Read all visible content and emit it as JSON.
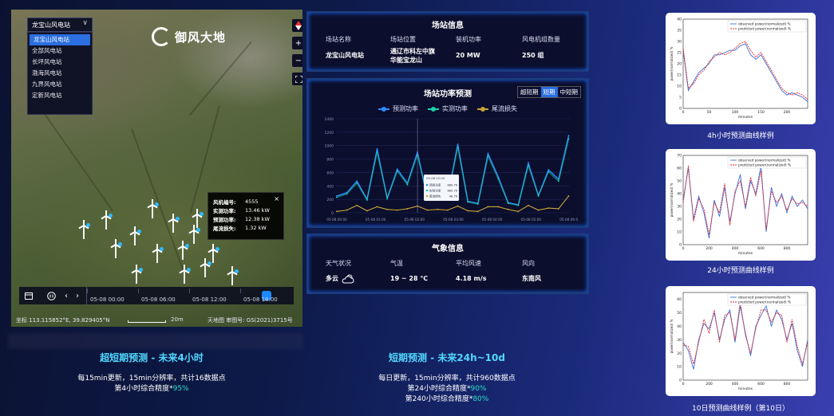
{
  "colors": {
    "accent_blue": "#2b6fe0",
    "pred_line": "#2e8bff",
    "actual_line": "#19d3a6",
    "wake_loss": "#c9a437",
    "observed_curve": "#3a6fd8",
    "predicted_curve": "#e0292e",
    "highlight_text": "#27e0c8"
  },
  "map": {
    "dropdown_value": "龙宝山风电站",
    "dropdown_icon": "chevron-down-icon",
    "menu_items": [
      "龙宝山风电站",
      "全部风电站",
      "长坪风电站",
      "渤海风电站",
      "九界风电站",
      "定新风电站"
    ],
    "logo_text": "御风大地",
    "controls": [
      "compass-icon",
      "zoom-in-icon",
      "zoom-out-icon",
      "fullscreen-icon"
    ],
    "tooltip": {
      "rows": [
        {
          "label": "风机编号:",
          "value": "4555"
        },
        {
          "label": "实测功率:",
          "value": "13.46 kW"
        },
        {
          "label": "预测功率:",
          "value": "12.38 kW"
        },
        {
          "label": "尾流损失:",
          "value": "1.32 kW"
        }
      ],
      "close": "×"
    },
    "timeline": {
      "ticks": [
        "05-08 00:00",
        "05-08 06:00",
        "05-08 12:00",
        "05-08 18:00"
      ],
      "icons": [
        "calendar-icon",
        "pause-icon",
        "prev-icon",
        "next-icon"
      ]
    },
    "status": {
      "coords": "坐标 113.115852°E, 39.829405°N",
      "scale": "20m",
      "credit": "天地图 审图号: GS(2021)3715号"
    }
  },
  "station": {
    "title": "场站信息",
    "labels": [
      "场站名称",
      "场站位置",
      "装机功率",
      "风电机组数量"
    ],
    "values": [
      "龙宝山风电站",
      "通辽市科左中旗\n华能宝龙山",
      "20 MW",
      "250 组"
    ]
  },
  "forecast": {
    "title": "场站功率预测",
    "tabs": [
      "超短期",
      "短期",
      "中短期"
    ],
    "active_tab": "短期",
    "legend": [
      "预测功率",
      "实测功率",
      "尾流损失"
    ]
  },
  "chart_data": {
    "type": "line",
    "title": "场站功率预测",
    "x": [
      "05-08 00:00",
      "05-08 00:15",
      "05-08 00:30",
      "05-08 00:45",
      "05-08 01:00",
      "05-08 01:15",
      "05-08 01:30",
      "05-08 01:45",
      "05-08 02:00",
      "05-08 02:15",
      "05-08 02:30",
      "05-08 02:45",
      "05-08 03:00",
      "05-08 03:15",
      "05-08 03:30",
      "05-08 03:45",
      "05-08 04:00",
      "05-08 04:15",
      "05-08 04:30",
      "05-08 04:45",
      "05-08 05:00",
      "05-08 05:15",
      "05-08 05:30",
      "05-08 05:45"
    ],
    "xticks": [
      "05-08 00:00",
      "05-08 01:00",
      "05-08 02:00",
      "05-08 03:00",
      "05-08 04:00",
      "05-08 05:00",
      "05-08 06:00"
    ],
    "yticks": [
      0,
      200,
      400,
      600,
      800,
      1000,
      1200,
      1400
    ],
    "ylim": [
      0,
      1400
    ],
    "series": [
      {
        "name": "预测功率",
        "values": [
          250,
          300,
          470,
          200,
          950,
          220,
          650,
          440,
          900,
          220,
          380,
          240,
          1020,
          170,
          140,
          880,
          540,
          150,
          120,
          740,
          260,
          640,
          500,
          1150
        ]
      },
      {
        "name": "实测功率",
        "values": [
          230,
          280,
          440,
          190,
          900,
          210,
          620,
          420,
          860,
          210,
          360,
          230,
          980,
          160,
          130,
          840,
          510,
          140,
          110,
          700,
          250,
          610,
          470,
          1100
        ]
      },
      {
        "name": "尾流损失",
        "values": [
          20,
          40,
          110,
          30,
          90,
          50,
          40,
          60,
          100,
          40,
          50,
          40,
          100,
          30,
          20,
          90,
          90,
          50,
          20,
          110,
          40,
          70,
          60,
          250
        ]
      }
    ],
    "tooltip": {
      "title": "05-08 02:00",
      "items": [
        {
          "name": "预测功率",
          "value": "880.76"
        },
        {
          "name": "实测功率",
          "value": "880.76"
        },
        {
          "name": "尾流损失",
          "value": "48.76"
        }
      ]
    }
  },
  "weather": {
    "title": "气象信息",
    "labels": [
      "天气状况",
      "气温",
      "平均风速",
      "风向"
    ],
    "values": [
      "多云",
      "19 ~ 28 ℃",
      "4.18 m/s",
      "东南风"
    ],
    "icon": "cloudy-icon"
  },
  "bottom": {
    "left_title": "超短期预测 - 未来4小时",
    "left_line1": "每15min更新，15min分辨率，共计16数据点",
    "left_line2_prefix": "第4小时综合精度*",
    "left_line2_value": "95%",
    "right_title": "短期预测 - 未来24h~10d",
    "right_line1": "每日更新，15min分辨率，共计960数据点",
    "right_line2_prefix": "第24小时综合精度*",
    "right_line2_value": "90%",
    "right_line3_prefix": "第240小时综合精度*",
    "right_line3_value": "80%"
  },
  "samples": [
    {
      "caption": "4h小时预测曲线样例",
      "legend": [
        "observed power(normalized) %",
        "predicted power(normalized) %"
      ],
      "xlabel": "minutes",
      "ylabel": "power(normalized) %",
      "xticks": [
        0,
        50,
        100,
        150,
        200
      ],
      "yticks": [
        0,
        5,
        10,
        15,
        20,
        25,
        30,
        35,
        40
      ],
      "xlim": [
        0,
        240
      ],
      "ylim": [
        0,
        40
      ],
      "x": [
        0,
        10,
        20,
        30,
        40,
        50,
        60,
        70,
        80,
        90,
        100,
        110,
        120,
        130,
        140,
        150,
        160,
        170,
        180,
        190,
        200,
        210,
        220,
        230,
        240
      ],
      "observed": [
        26,
        8,
        12,
        16,
        18,
        20,
        24,
        24,
        25,
        26,
        26,
        28,
        29,
        24,
        22,
        24,
        20,
        16,
        12,
        8,
        6,
        7,
        6,
        5,
        3
      ],
      "predicted": [
        27,
        9,
        11,
        15,
        17,
        21,
        23,
        25,
        24,
        25,
        27,
        29,
        30,
        26,
        23,
        25,
        21,
        17,
        13,
        9,
        7,
        6,
        7,
        6,
        4
      ]
    },
    {
      "caption": "24小时预测曲线样例",
      "legend": [
        "observed power(normalized) %",
        "predicted power(normalized) %"
      ],
      "xlabel": "minutes",
      "ylabel": "power(normalized) %",
      "xticks": [
        0,
        200,
        400,
        600,
        800
      ],
      "yticks": [
        0,
        10,
        20,
        30,
        40,
        50,
        60,
        70
      ],
      "xlim": [
        0,
        960
      ],
      "ylim": [
        0,
        70
      ],
      "x": [
        0,
        40,
        80,
        120,
        160,
        200,
        240,
        280,
        320,
        360,
        400,
        440,
        480,
        520,
        560,
        600,
        640,
        680,
        720,
        760,
        800,
        840,
        880,
        920,
        960
      ],
      "observed": [
        35,
        60,
        20,
        38,
        25,
        5,
        35,
        22,
        45,
        18,
        40,
        55,
        28,
        50,
        40,
        62,
        10,
        45,
        30,
        40,
        25,
        38,
        30,
        35,
        28
      ],
      "predicted": [
        33,
        62,
        18,
        36,
        28,
        8,
        33,
        25,
        48,
        15,
        42,
        50,
        30,
        53,
        38,
        58,
        12,
        42,
        33,
        38,
        27,
        36,
        32,
        33,
        30
      ]
    },
    {
      "caption": "10日预测曲线样例（第10日）",
      "legend": [
        "observed power(normalized) %",
        "predicted power(normalized) %"
      ],
      "xlabel": "minutes",
      "ylabel": "power(normalized) %",
      "xticks": [
        0,
        200,
        400,
        600,
        800
      ],
      "yticks": [
        0,
        10,
        20,
        30,
        40,
        50,
        60
      ],
      "xlim": [
        0,
        960
      ],
      "ylim": [
        0,
        65
      ],
      "x": [
        0,
        40,
        80,
        120,
        160,
        200,
        240,
        280,
        320,
        360,
        400,
        440,
        480,
        520,
        560,
        600,
        640,
        680,
        720,
        760,
        800,
        840,
        880,
        920,
        960
      ],
      "observed": [
        28,
        22,
        8,
        30,
        42,
        38,
        50,
        30,
        45,
        52,
        28,
        55,
        35,
        18,
        40,
        48,
        55,
        40,
        52,
        45,
        30,
        42,
        22,
        10,
        30
      ],
      "predicted": [
        26,
        25,
        12,
        28,
        45,
        35,
        52,
        28,
        48,
        50,
        30,
        58,
        33,
        20,
        38,
        52,
        52,
        43,
        50,
        48,
        28,
        45,
        25,
        12,
        28
      ]
    }
  ]
}
